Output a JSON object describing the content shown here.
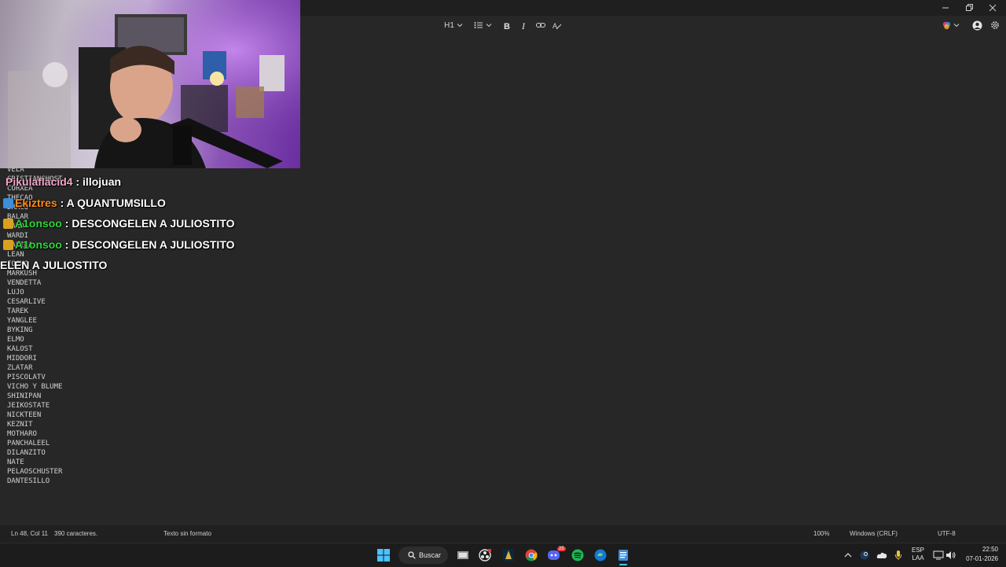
{
  "toolbar": {
    "heading": "H1"
  },
  "editor": {
    "lines": [
      "VELA",
      "CRISTIANGHOST",
      "CORXEA",
      "THECAO",
      "DRACU",
      "BALAR",
      "JANO",
      "WARDI",
      "VALINA",
      "LEAN",
      "FOCHO",
      "MARKUSH",
      "VENDETTA",
      "LUJO",
      "CESARLIVE",
      "TAREK",
      "YANGLEE",
      "BYKING",
      "ELMO",
      "KALOST",
      "MIDDORI",
      "ZLATAR",
      "PISCOLATV",
      "VICHO Y BLUME",
      "SHINIPAN",
      "JEIKOSTATE",
      "NICKTEEN",
      "KEZNIT",
      "MOTHARO",
      "PANCHALEEL",
      "DILANZITO",
      "NATE",
      "PELAOSCHUSTER",
      "DANTESILLO"
    ]
  },
  "chat": [
    {
      "user": "Pikulaflacid4",
      "sep": " : ",
      "message": "illojuan",
      "user_color": "#f4a6c8",
      "badge": ""
    },
    {
      "user": "Ekiztres",
      "sep": " : ",
      "message": "A QUANTUMSILLO",
      "user_color": "#ff8c1a",
      "badge": "#3a8fd8"
    },
    {
      "user": "A1onsoo",
      "sep": " : ",
      "message": "DESCONGELEN A JULIOSTITO",
      "user_color": "#2fd63a",
      "badge": "#d8a21f"
    },
    {
      "user": "A1onsoo",
      "sep": " : ",
      "message": "DESCONGELEN A JULIOSTITO",
      "user_color": "#2fd63a",
      "badge": "#d8a21f"
    },
    {
      "user": "",
      "sep": "",
      "message": "ELEN A JULIOSTITO",
      "user_color": "#ffffff",
      "badge": ""
    }
  ],
  "status": {
    "position": "Ln 48, Col 11",
    "chars": "390 caracteres.",
    "format": "Texto sin formato",
    "zoom": "100%",
    "line_ending": "Windows (CRLF)",
    "encoding": "UTF-8"
  },
  "taskbar": {
    "search_label": "Buscar",
    "lang_top": "ESP",
    "lang_bottom": "LAA",
    "time": "22:50",
    "date": "07-01-2026",
    "discord_badge": "25"
  }
}
